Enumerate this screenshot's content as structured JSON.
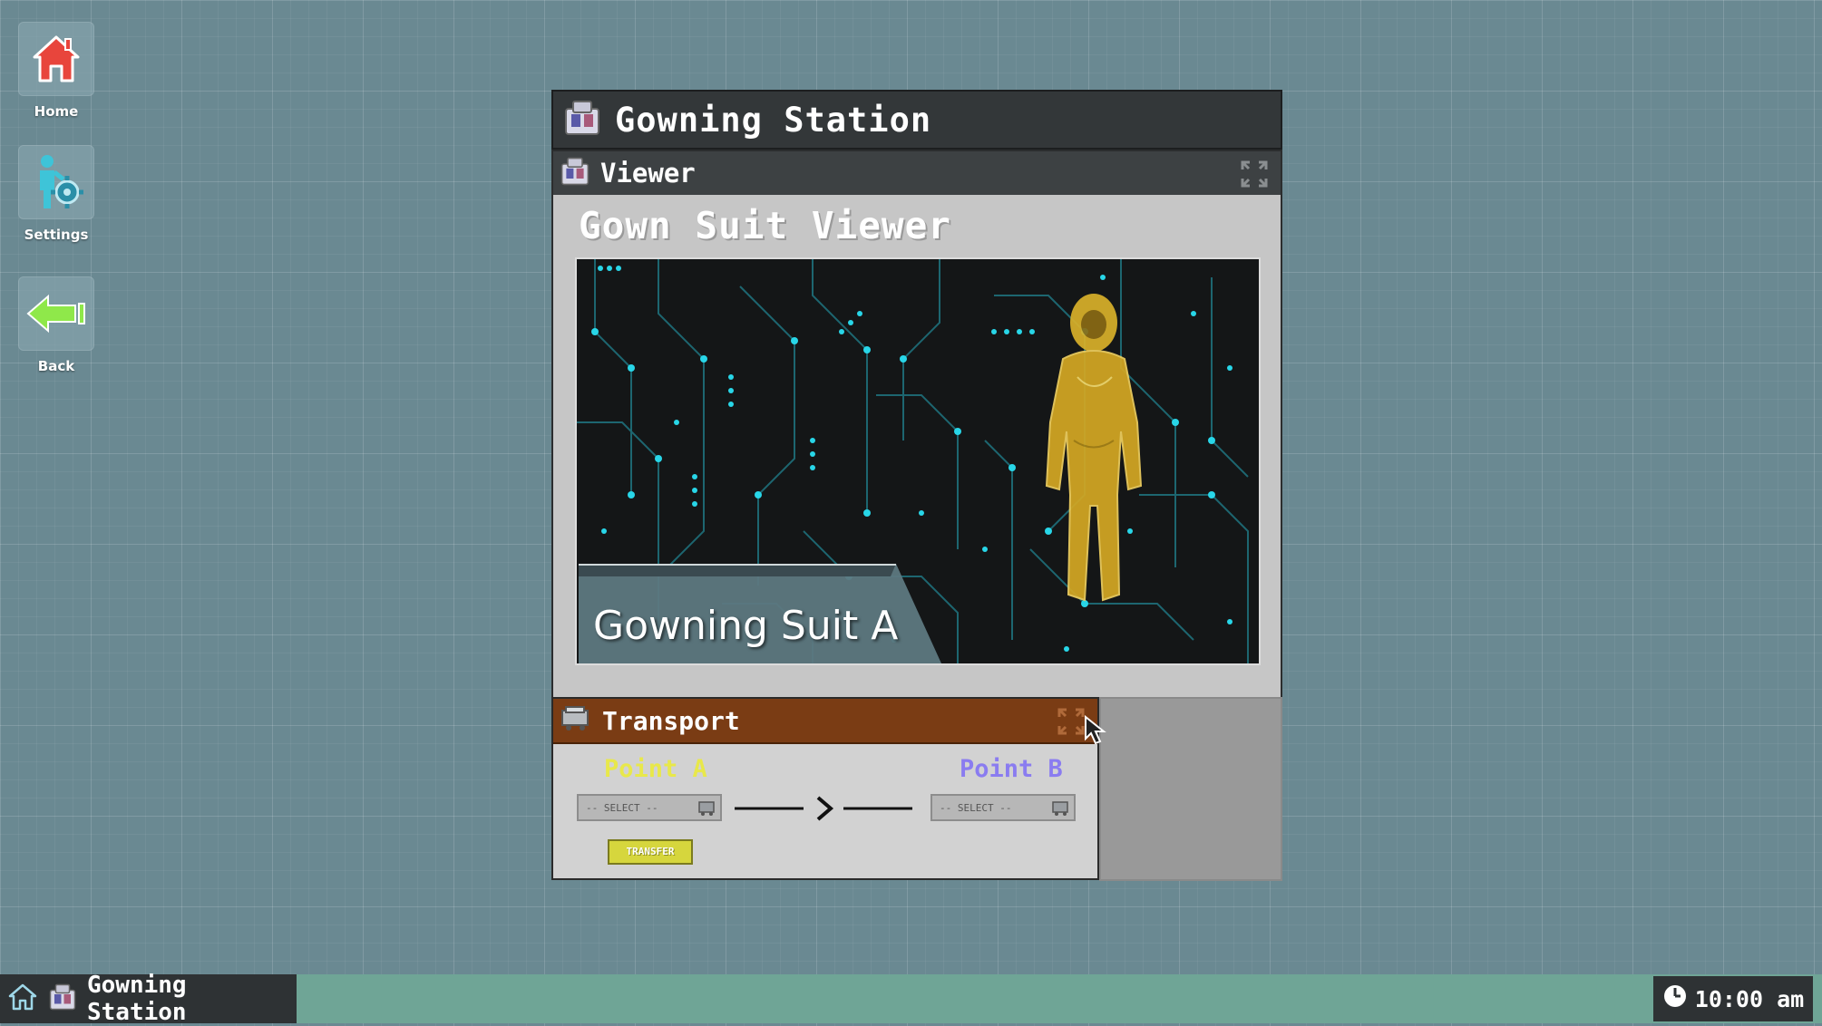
{
  "desktop": {
    "icons": [
      {
        "label": "Home"
      },
      {
        "label": "Settings"
      },
      {
        "label": "Back"
      }
    ]
  },
  "window": {
    "title": "Gowning Station"
  },
  "viewer": {
    "header": "Viewer",
    "title": "Gown Suit Viewer",
    "suit_label": "Gowning Suit A"
  },
  "transport": {
    "header": "Transport",
    "point_a": "Point A",
    "point_b": "Point B",
    "point_a_select": "-- SELECT --",
    "point_b_select": "-- SELECT --",
    "transfer_label": "TRANSFER"
  },
  "taskbar": {
    "task_title": "Gowning Station",
    "clock": "10:00 am"
  },
  "colors": {
    "point_a": "#e8e84a",
    "point_b": "#8a7cf0",
    "transport_header": "#7a3c14",
    "taskbar": "#6fa596"
  }
}
